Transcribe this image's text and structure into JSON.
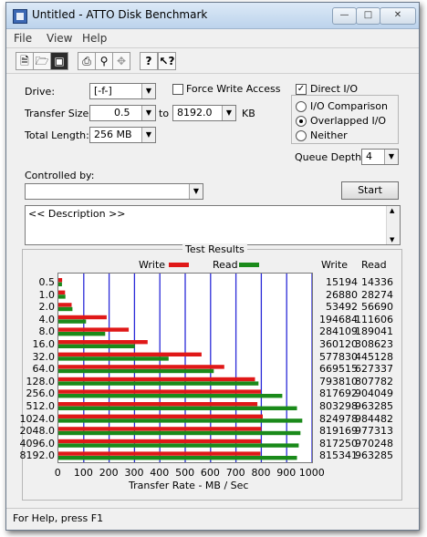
{
  "window": {
    "title": "Untitled - ATTO Disk Benchmark",
    "min_icon": "minimize-icon",
    "max_icon": "maximize-icon",
    "close_icon": "close-icon"
  },
  "menu": [
    "File",
    "View",
    "Help"
  ],
  "toolbar": [
    "new-icon",
    "open-icon",
    "save-icon",
    "print-icon",
    "print-preview-icon",
    "move-icon",
    "help-icon",
    "context-help-icon"
  ],
  "form": {
    "drive_label": "Drive:",
    "drive_value": "[-f-]",
    "force_write_label": "Force Write Access",
    "direct_io_label": "Direct I/O",
    "direct_io_checked": "✓",
    "transfer_size_label": "Transfer Size:",
    "transfer_from": "0.5",
    "to_label": "to",
    "transfer_to": "8192.0",
    "kb_label": "KB",
    "total_length_label": "Total Length:",
    "total_length_value": "256 MB",
    "io_comparison_label": "I/O Comparison",
    "overlapped_io_label": "Overlapped I/O",
    "neither_label": "Neither",
    "queue_depth_label": "Queue Depth:",
    "queue_depth_value": "4",
    "controlled_by_label": "Controlled by:",
    "controlled_by_value": "",
    "start_label": "Start",
    "description_text": "<< Description >>"
  },
  "results": {
    "group_title": "Test Results",
    "write_legend": "Write",
    "read_legend": "Read",
    "write_col": "Write",
    "read_col": "Read"
  },
  "chart_data": {
    "type": "bar",
    "orientation": "horizontal",
    "categories": [
      "0.5",
      "1.0",
      "2.0",
      "4.0",
      "8.0",
      "16.0",
      "32.0",
      "64.0",
      "128.0",
      "256.0",
      "512.0",
      "1024.0",
      "2048.0",
      "4096.0",
      "8192.0"
    ],
    "series": [
      {
        "name": "Write",
        "color": "#e01818",
        "values": [
          15194,
          26880,
          53492,
          194684,
          284109,
          360120,
          577830,
          669515,
          793810,
          817692,
          803298,
          824978,
          819169,
          817250,
          815341
        ]
      },
      {
        "name": "Read",
        "color": "#1a8a1a",
        "values": [
          14336,
          28274,
          56690,
          111606,
          189041,
          308623,
          445128,
          627337,
          807782,
          904049,
          963285,
          984482,
          977313,
          970248,
          963285
        ]
      }
    ],
    "write_text": [
      "15194",
      "26880",
      "53492",
      "194684",
      "284109",
      "360120",
      "577830",
      "669515",
      "793810",
      "817692",
      "803298",
      "824978",
      "819169",
      "817250",
      "815341"
    ],
    "read_text": [
      "14336",
      "28274",
      "56690",
      "111606",
      "189041",
      "308623",
      "445128",
      "627337",
      "807782",
      "904049",
      "963285",
      "984482",
      "977313",
      "970248",
      "963285"
    ],
    "xlabel": "Transfer Rate - MB / Sec",
    "xticks": [
      "0",
      "100",
      "200",
      "300",
      "400",
      "500",
      "600",
      "700",
      "800",
      "900",
      "1000"
    ],
    "xlim": [
      0,
      1000
    ],
    "grid": true
  },
  "status": "For Help, press F1"
}
